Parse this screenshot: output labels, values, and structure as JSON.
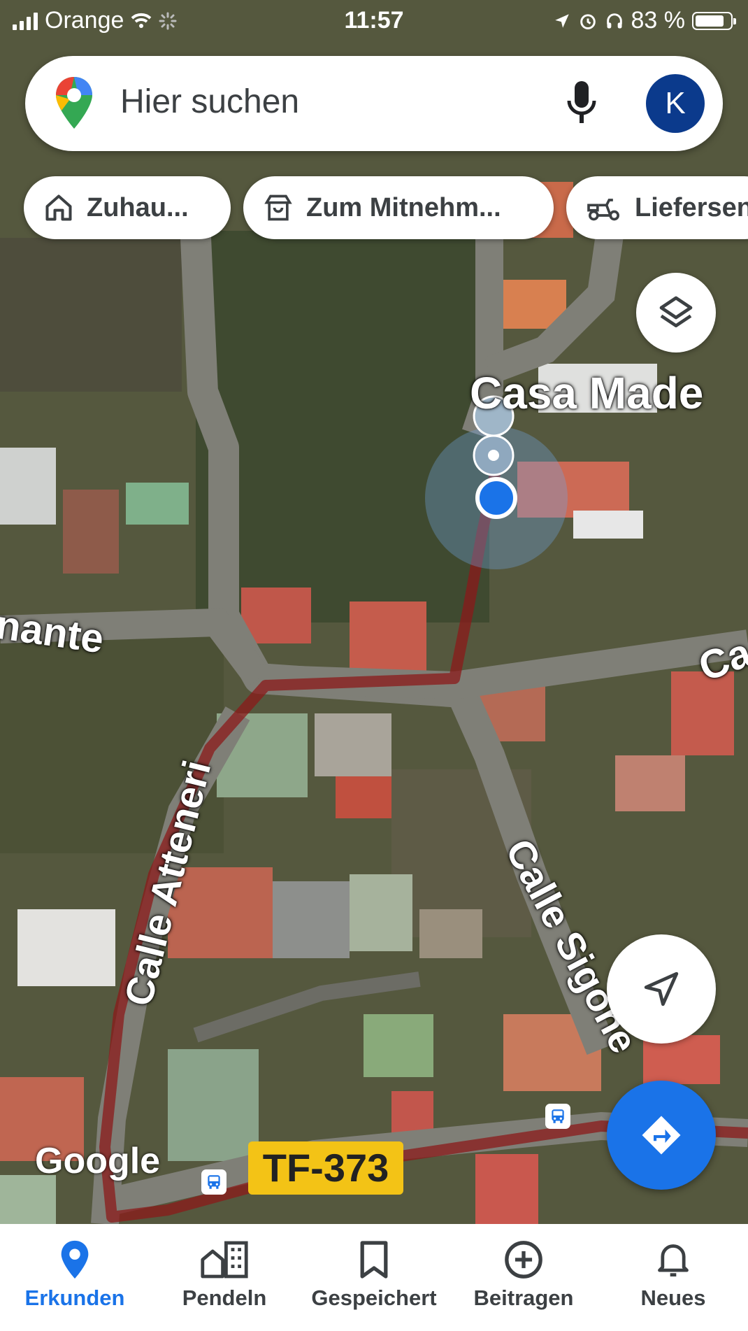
{
  "status_bar": {
    "carrier": "Orange",
    "time": "11:57",
    "battery": "83 %"
  },
  "search": {
    "placeholder": "Hier suchen",
    "avatar_initial": "K"
  },
  "chips": [
    {
      "label": "Zuhau...",
      "icon": "home-icon"
    },
    {
      "label": "Zum Mitnehm...",
      "icon": "takeout-icon"
    },
    {
      "label": "Liefersen",
      "icon": "delivery-icon"
    }
  ],
  "map_labels": {
    "place": "Casa Made",
    "street_left": "nante",
    "street_atteneri": "Calle Atteneri",
    "street_sigone": "Calle Sigone",
    "street_right": "Ca",
    "road_shield": "TF-373",
    "attribution": "Google"
  },
  "nav": [
    {
      "label": "Erkunden",
      "icon": "explore-pin-icon",
      "active": true
    },
    {
      "label": "Pendeln",
      "icon": "commute-icon",
      "active": false
    },
    {
      "label": "Gespeichert",
      "icon": "saved-bookmark-icon",
      "active": false
    },
    {
      "label": "Beitragen",
      "icon": "contribute-plus-icon",
      "active": false
    },
    {
      "label": "Neues",
      "icon": "updates-bell-icon",
      "active": false
    }
  ],
  "colors": {
    "accent": "#1a73e8",
    "route": "#8b1a1a",
    "road_shield": "#f3c316"
  }
}
